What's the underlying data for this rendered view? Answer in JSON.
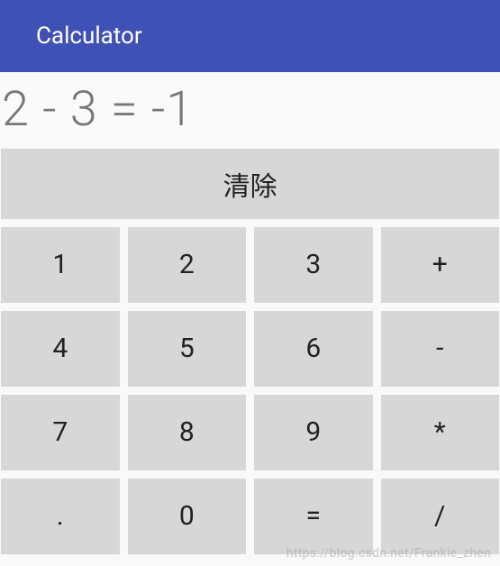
{
  "header": {
    "title": "Calculator"
  },
  "display": {
    "expression": "2 - 3 = -1"
  },
  "buttons": {
    "clear": "清除",
    "grid": [
      [
        "1",
        "2",
        "3",
        "+"
      ],
      [
        "4",
        "5",
        "6",
        "-"
      ],
      [
        "7",
        "8",
        "9",
        "*"
      ],
      [
        ".",
        "0",
        "=",
        "/"
      ]
    ]
  },
  "watermark": "https://blog.csdn.net/Frankie_zhen"
}
